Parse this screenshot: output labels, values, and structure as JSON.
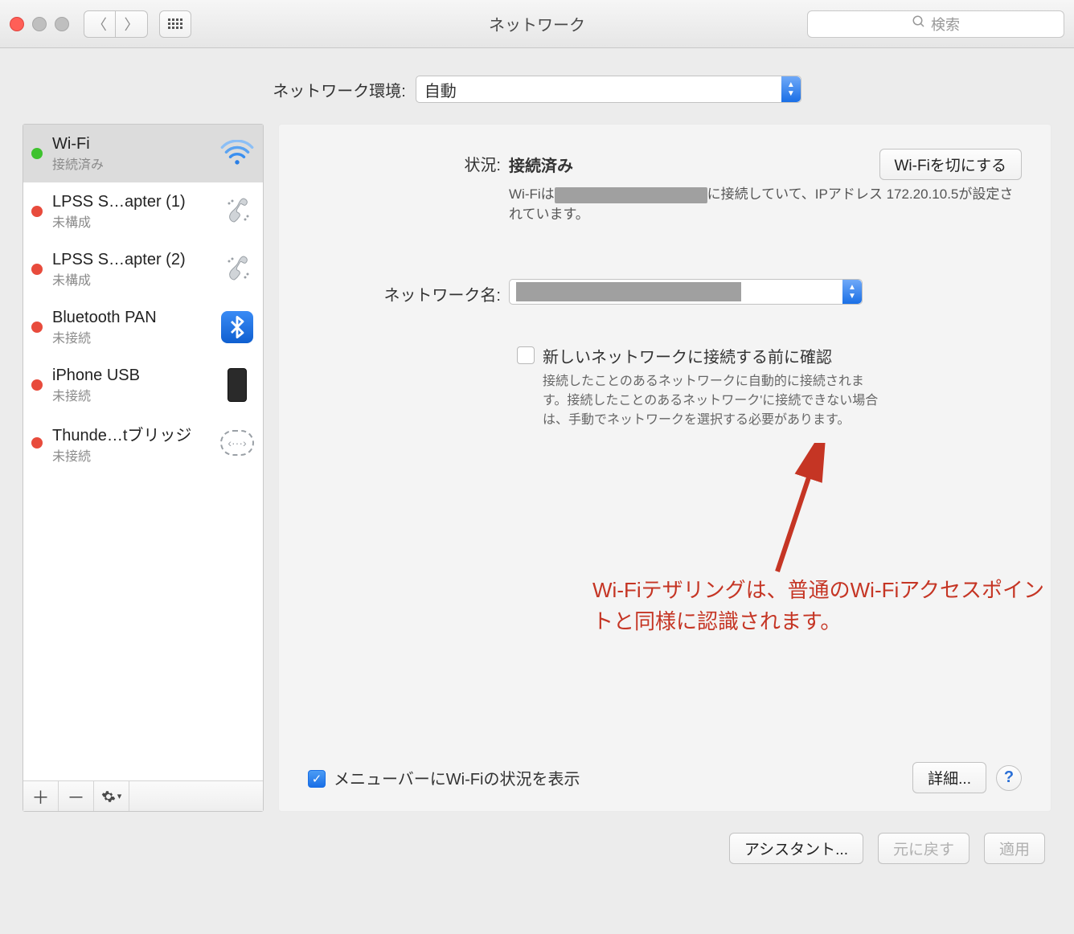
{
  "window": {
    "title": "ネットワーク",
    "search_placeholder": "検索"
  },
  "location": {
    "label": "ネットワーク環境:",
    "value": "自動"
  },
  "sidebar": {
    "items": [
      {
        "name": "Wi-Fi",
        "status": "接続済み",
        "dot": "green",
        "icon": "wifi"
      },
      {
        "name": "LPSS S…apter (1)",
        "status": "未構成",
        "dot": "red",
        "icon": "serial"
      },
      {
        "name": "LPSS S…apter (2)",
        "status": "未構成",
        "dot": "red",
        "icon": "serial"
      },
      {
        "name": "Bluetooth PAN",
        "status": "未接続",
        "dot": "red",
        "icon": "bluetooth"
      },
      {
        "name": "iPhone USB",
        "status": "未接続",
        "dot": "red",
        "icon": "iphone"
      },
      {
        "name": "Thunde…tブリッジ",
        "status": "未接続",
        "dot": "red",
        "icon": "thunderbolt"
      }
    ]
  },
  "detail": {
    "status_label": "状況:",
    "status_value": "接続済み",
    "wifi_off_btn": "Wi-Fiを切にする",
    "status_desc_prefix": "Wi-Fiは",
    "status_desc_suffix": "に接続していて、IPアドレス 172.20.10.5が設定されています。",
    "netname_label": "ネットワーク名:",
    "ask_label": "新しいネットワークに接続する前に確認",
    "ask_desc": "接続したことのあるネットワークに自動的に接続されます。接続したことのあるネットワーク'に接続できない場合は、手動でネットワークを選択する必要があります。",
    "menubar_label": "メニューバーにWi-Fiの状況を表示",
    "advanced_btn": "詳細..."
  },
  "annotation": {
    "text": "Wi-Fiテザリングは、普通のWi-Fiアクセスポイントと同様に認識されます。"
  },
  "bottom": {
    "assistant": "アシスタント...",
    "revert": "元に戻す",
    "apply": "適用"
  }
}
